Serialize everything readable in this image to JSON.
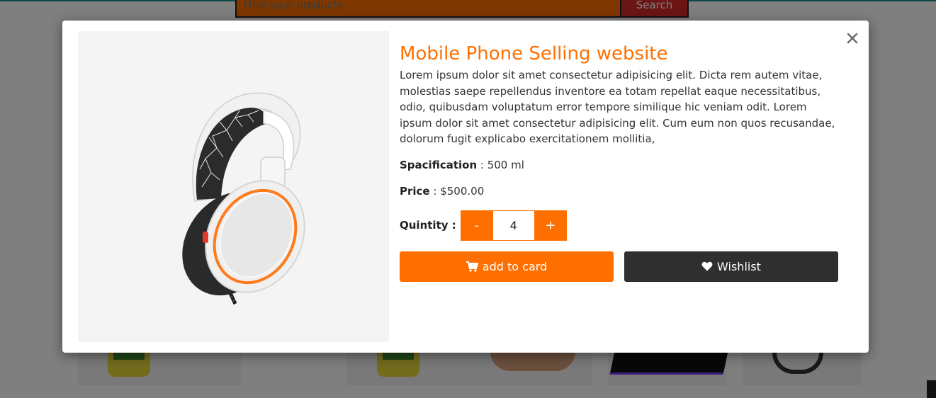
{
  "background": {
    "search": {
      "placeholder": "Find your products",
      "button_label": "Search"
    }
  },
  "modal": {
    "close_label": "×",
    "title": "Mobile Phone Selling website",
    "description": "Lorem ipsum dolor sit amet consectetur adipisicing elit. Dicta rem autem vitae, molestias saepe repellendus inventore ea totam repellat eaque necessitatibus, odio, quibusdam voluptatum error tempore similique hic veniam odit. Lorem ipsum dolor sit amet consectetur adipisicing elit. Cum eum non quos recusandae, dolorum fugit explicabo exercitationem mollitia,",
    "specification": {
      "label": "Spacification",
      "separator": " : ",
      "value": "500 ml"
    },
    "price": {
      "label": "Price",
      "separator": " : ",
      "value": "$500.00"
    },
    "quantity": {
      "label": "Quintity :",
      "minus_label": "-",
      "value": "4",
      "plus_label": "+"
    },
    "buttons": {
      "add_to_cart": {
        "label": "add to card",
        "icon": "shopping-cart-icon"
      },
      "wishlist": {
        "label": "Wishlist",
        "icon": "heart-icon"
      }
    },
    "product_image": "headphones-image"
  },
  "colors": {
    "accent": "#ff6f00",
    "dark_button": "#2f2f2f",
    "overlay": "rgba(0,0,0,0.5)"
  }
}
